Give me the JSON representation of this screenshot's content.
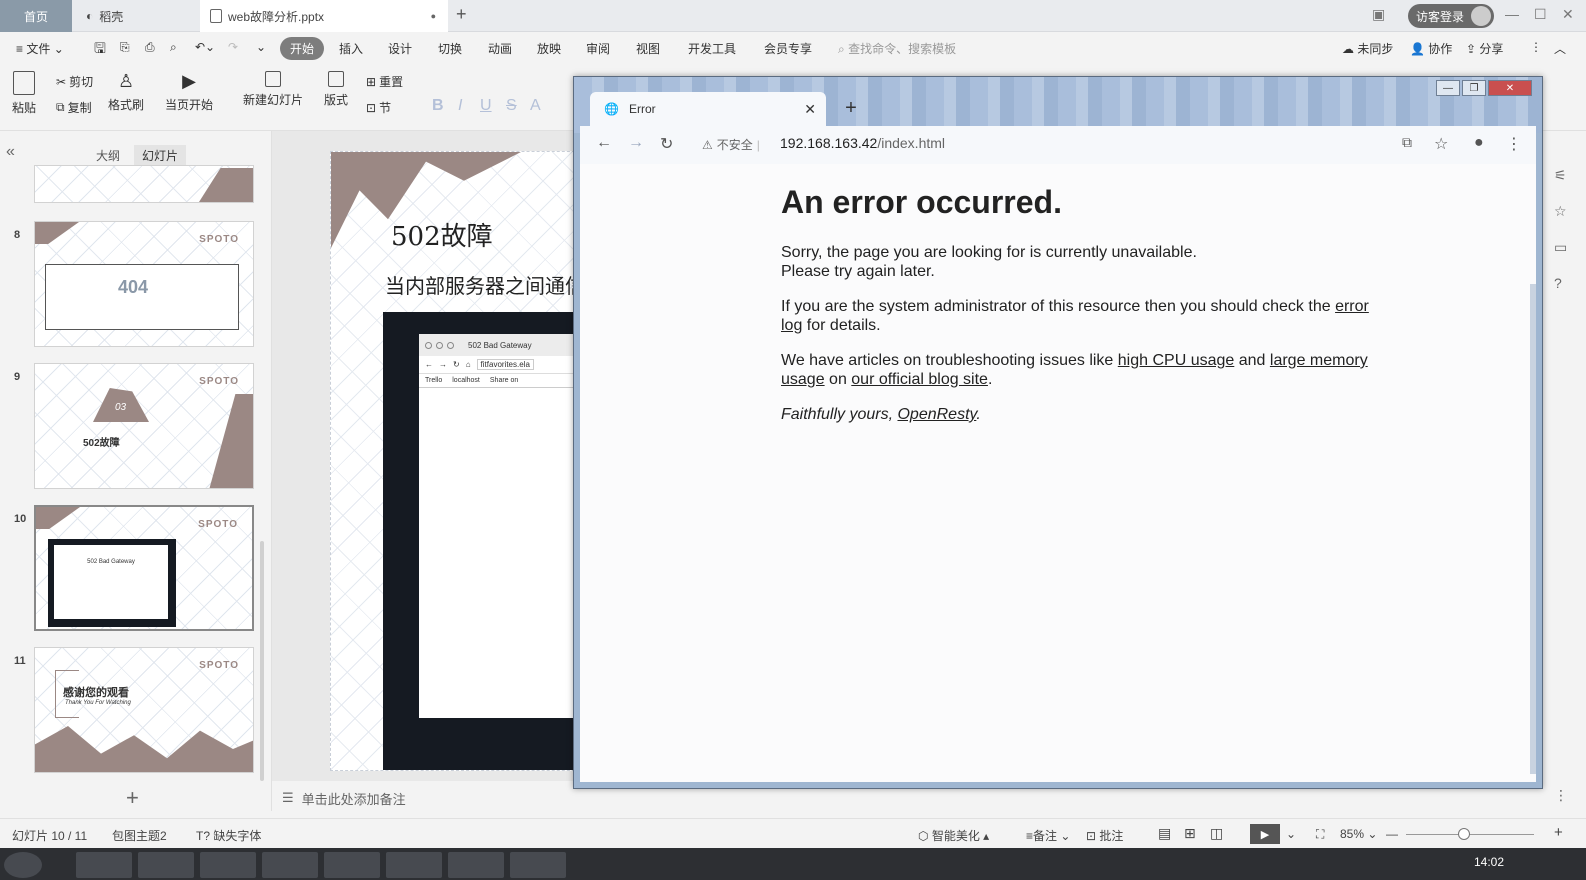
{
  "wps": {
    "tabs": {
      "home": "首页",
      "daoke": "稻壳",
      "file": "web故障分析.pptx"
    },
    "login": "访客登录",
    "menu": [
      "文件",
      "开始",
      "插入",
      "设计",
      "切换",
      "动画",
      "放映",
      "审阅",
      "视图",
      "开发工具",
      "会员专享"
    ],
    "search_placeholder": "查找命令、搜索模板",
    "right_menu": {
      "sync": "未同步",
      "collab": "协作",
      "share": "分享"
    },
    "ribbon": {
      "paste": "粘贴",
      "cut": "剪切",
      "copy": "复制",
      "format_painter": "格式刷",
      "from_current": "当页开始",
      "new_slide": "新建幻灯片",
      "layout": "版式",
      "reset": "重置",
      "section": "节"
    },
    "left_panel": {
      "outline": "大纲",
      "slides": "幻灯片"
    },
    "thumbs": [
      {
        "num": "8",
        "brand": "SPOTO",
        "big": "404"
      },
      {
        "num": "9",
        "brand": "SPOTO",
        "badge": "03",
        "title": "502故障"
      },
      {
        "num": "10",
        "brand": "SPOTO",
        "inner": "502 Bad Gateway"
      },
      {
        "num": "11",
        "brand": "SPOTO",
        "title": "感谢您的观看",
        "subtitle": "Thank You For Watching"
      }
    ],
    "slide": {
      "title": "502故障",
      "subtitle": "当内部服务器之间通信",
      "inner_tab": "502 Bad Gateway",
      "inner_url": "fitfavorites.ela",
      "bookmarks": [
        "Trello",
        "localhost",
        "Share on"
      ]
    },
    "notes_placeholder": "单击此处添加备注",
    "status": {
      "slide_counter": "幻灯片 10 / 11",
      "theme": "包图主题2",
      "missing_font": "缺失字体",
      "beautify": "智能美化",
      "notes": "备注",
      "comments": "批注",
      "zoom": "85%"
    },
    "clock": "14:02"
  },
  "browser": {
    "tab_title": "Error",
    "insecure": "不安全",
    "url_host": "192.168.163.42",
    "url_path": "/index.html",
    "error": {
      "heading": "An error occurred.",
      "p1_line1": "Sorry, the page you are looking for is currently unavailable.",
      "p1_line2": "Please try again later.",
      "p2_before": "If you are the system administrator of this resource then you should check the ",
      "p2_link": "error log",
      "p2_after": " for details.",
      "p3_before": "We have articles on troubleshooting issues like ",
      "p3_link1": "high CPU usage",
      "p3_mid": " and ",
      "p3_link2": "large memory usage",
      "p3_on": " on ",
      "p3_link3": "our official blog site",
      "p3_end": ".",
      "sig_before": "Faithfully yours, ",
      "sig_link": "OpenResty",
      "sig_end": "."
    }
  }
}
